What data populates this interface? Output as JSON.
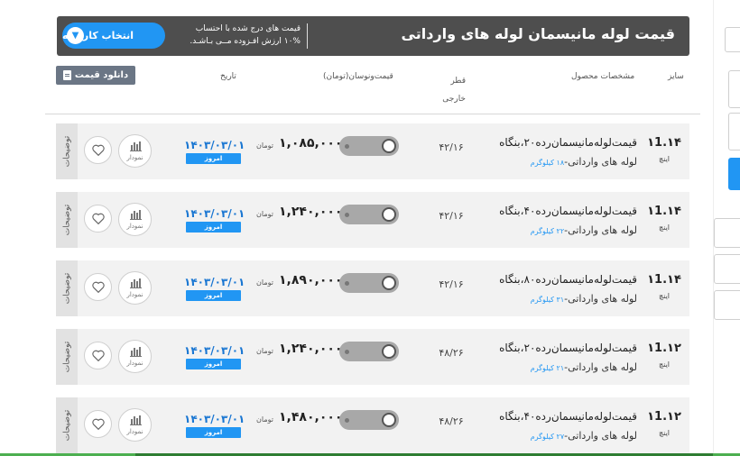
{
  "header": {
    "title": "قیمت لوله مانیسمان لوله های وارداتی",
    "vat_line1": "قیمت های درج شده با احتساب",
    "vat_line2": "۱۰% ارزش افـزوده مــی بـاشـد.",
    "factory_button": "انتخاب کارخانه"
  },
  "download_label": "دانلود قیمت",
  "columns": {
    "size": "سایز",
    "specs": "مشخصات محصول",
    "diameter": "قطر خارجی",
    "price": "قیمت‌ونوسان(تومان)",
    "date": "تاریخ"
  },
  "row_labels": {
    "side": "توضیحات",
    "chart": "نمودار",
    "today": "امروز",
    "unit": "تومان",
    "inch": "اینچ",
    "kg_suffix": "کیلوگرم"
  },
  "rows": [
    {
      "size": "۱1.۱۴",
      "name": "قیمت‌لوله‌مانیسمان‌رده‌۲۰،بنگاه",
      "sub": "لوله های وارداتی-",
      "weight": "۱۸",
      "diameter": "۴۲/۱۶",
      "price": "۱,۰۸۵,۰۰۰",
      "date": "۱۴۰۳/۰۳/۰۱"
    },
    {
      "size": "۱1.۱۴",
      "name": "قیمت‌لوله‌مانیسمان‌رده‌۴۰،بنگاه",
      "sub": "لوله های وارداتی-",
      "weight": "۲۲",
      "diameter": "۴۲/۱۶",
      "price": "۱,۲۴۰,۰۰۰",
      "date": "۱۴۰۳/۰۳/۰۱"
    },
    {
      "size": "۱1.۱۴",
      "name": "قیمت‌لوله‌مانیسمان‌رده‌۸۰،بنگاه",
      "sub": "لوله های وارداتی-",
      "weight": "۳۱",
      "diameter": "۴۲/۱۶",
      "price": "۱,۸۹۰,۰۰۰",
      "date": "۱۴۰۳/۰۳/۰۱"
    },
    {
      "size": "۱1.۱۲",
      "name": "قیمت‌لوله‌مانیسمان‌رده‌۲۰،بنگاه",
      "sub": "لوله های وارداتی-",
      "weight": "۲۱",
      "diameter": "۴۸/۲۶",
      "price": "۱,۲۴۰,۰۰۰",
      "date": "۱۴۰۳/۰۳/۰۱"
    },
    {
      "size": "۱1.۱۲",
      "name": "قیمت‌لوله‌مانیسمان‌رده‌۴۰،بنگاه",
      "sub": "لوله های وارداتی-",
      "weight": "۲۷",
      "diameter": "۴۸/۲۶",
      "price": "۱,۴۸۰,۰۰۰",
      "date": "۱۴۰۳/۰۳/۰۱"
    }
  ]
}
